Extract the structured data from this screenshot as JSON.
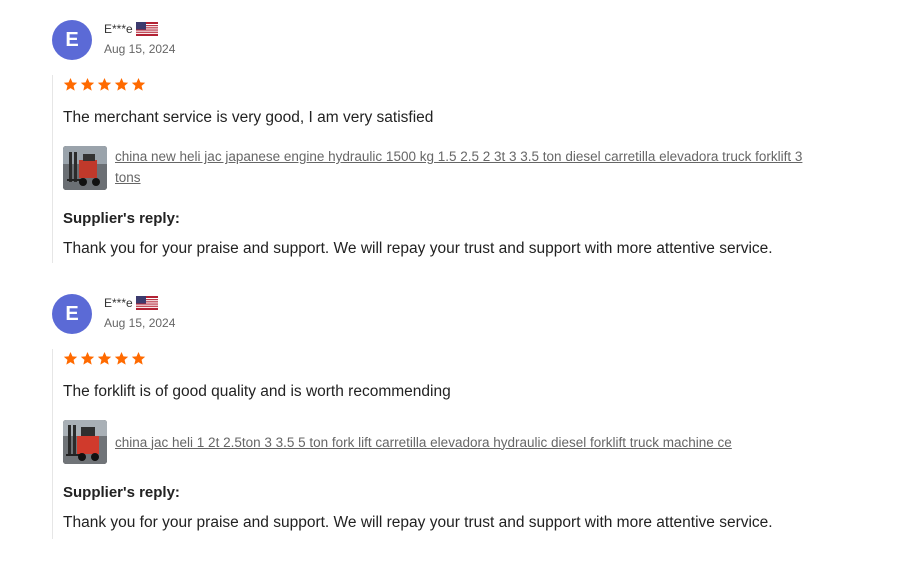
{
  "reviews": [
    {
      "avatar_letter": "E",
      "user": "E***e",
      "country_flag": "us-flag",
      "date": "Aug 15, 2024",
      "rating": 5,
      "comment": "The merchant service is very good, I am very satisfied",
      "product_title": "china new heli jac japanese engine hydraulic 1500 kg 1.5 2.5 2 3t 3 3.5 ton diesel carretilla elevadora truck forklift 3 tons",
      "reply_label": "Supplier's reply:",
      "reply_text": "Thank you for your praise and support. We will repay your trust and support with more attentive service."
    },
    {
      "avatar_letter": "E",
      "user": "E***e",
      "country_flag": "us-flag",
      "date": "Aug 15, 2024",
      "rating": 5,
      "comment": "The forklift is of good quality and is worth recommending",
      "product_title": "china jac heli 1 2t 2.5ton 3 3.5 5 ton fork lift carretilla elevadora hydraulic diesel forklift truck machine ce",
      "reply_label": "Supplier's reply:",
      "reply_text": "Thank you for your praise and support. We will repay your trust and support with more attentive service."
    }
  ],
  "colors": {
    "star": "#ff6a00",
    "avatar": "#5b6ad6",
    "link": "#666666"
  }
}
